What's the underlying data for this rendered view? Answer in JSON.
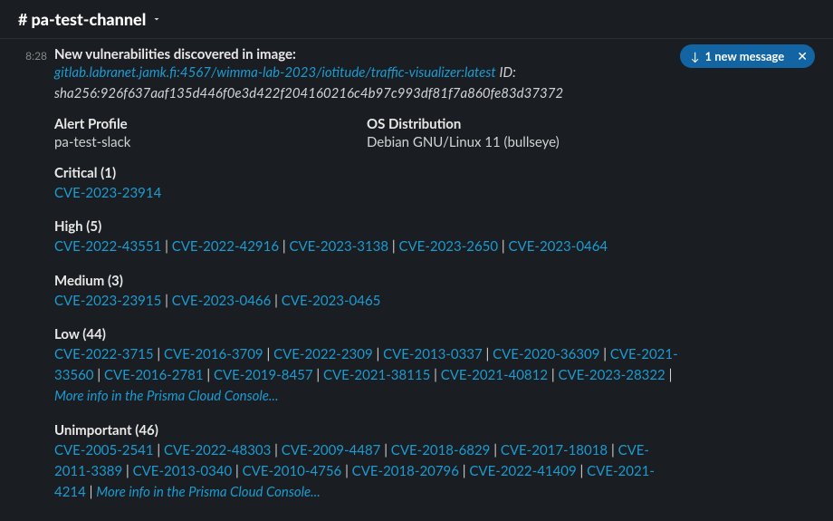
{
  "channel": {
    "name": "pa-test-channel"
  },
  "timestamp": "8:28",
  "notification": {
    "label": "1 new message"
  },
  "message": {
    "headline": "New vulnerabilities discovered in image:",
    "image_ref": "gitlab.labranet.jamk.fi:4567/wimma-lab-2023/iotitude/traffic-visualizer:latest",
    "id_label": "ID:",
    "sha": "sha256:926f637aaf135d446f0e3d422f204160216c4b97c993df81f7a860fe83d37372"
  },
  "fields": {
    "alert_profile": {
      "label": "Alert Profile",
      "value": "pa-test-slack"
    },
    "os_dist": {
      "label": "OS Distribution",
      "value": "Debian GNU/Linux 11 (bullseye)"
    }
  },
  "more_info_label": "More info in the Prisma Cloud Console...",
  "categories": [
    {
      "title": "Critical (1)",
      "cves": [
        "CVE-2023-23914"
      ],
      "more_info": false
    },
    {
      "title": "High (5)",
      "cves": [
        "CVE-2022-43551",
        "CVE-2022-42916",
        "CVE-2023-3138",
        "CVE-2023-2650",
        "CVE-2023-0464"
      ],
      "more_info": false
    },
    {
      "title": "Medium (3)",
      "cves": [
        "CVE-2023-23915",
        "CVE-2023-0466",
        "CVE-2023-0465"
      ],
      "more_info": false
    },
    {
      "title": "Low (44)",
      "cves": [
        "CVE-2022-3715",
        "CVE-2016-3709",
        "CVE-2022-2309",
        "CVE-2013-0337",
        "CVE-2020-36309",
        "CVE-2021-33560",
        "CVE-2016-2781",
        "CVE-2019-8457",
        "CVE-2021-38115",
        "CVE-2021-40812",
        "CVE-2023-28322"
      ],
      "more_info": true
    },
    {
      "title": "Unimportant (46)",
      "cves": [
        "CVE-2005-2541",
        "CVE-2022-48303",
        "CVE-2009-4487",
        "CVE-2018-6829",
        "CVE-2017-18018",
        "CVE-2011-3389",
        "CVE-2013-0340",
        "CVE-2010-4756",
        "CVE-2018-20796",
        "CVE-2022-41409",
        "CVE-2021-4214"
      ],
      "more_info": true
    }
  ]
}
